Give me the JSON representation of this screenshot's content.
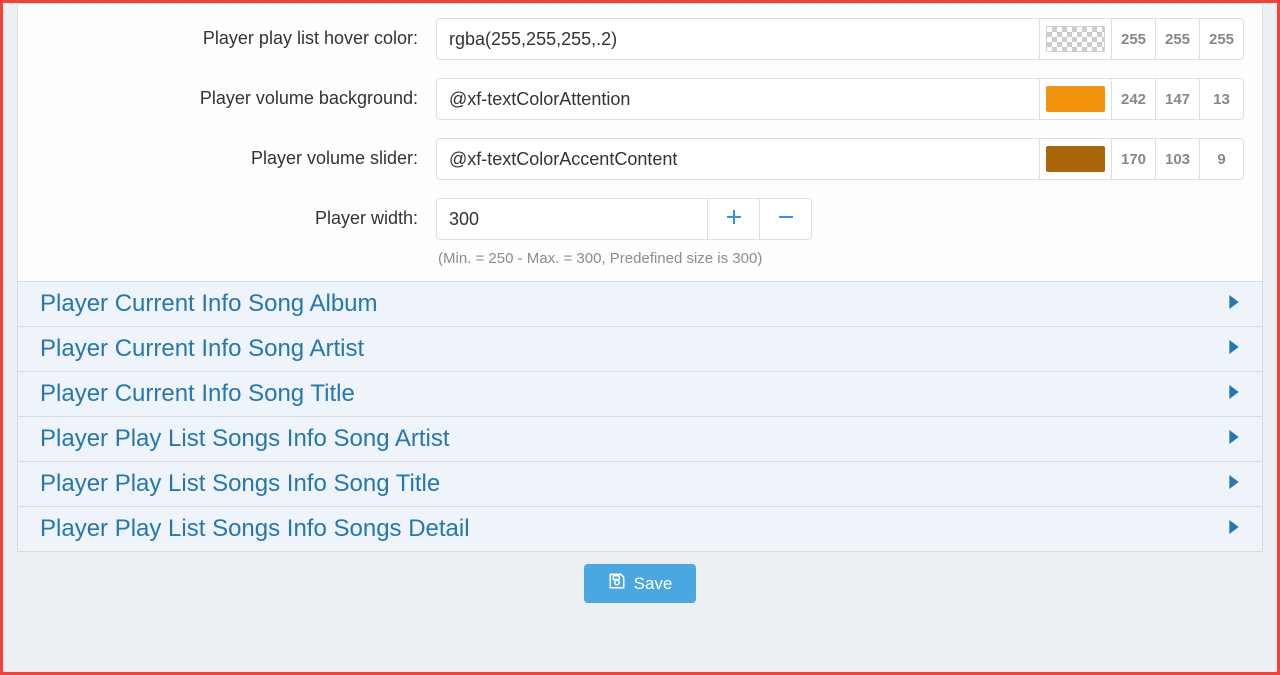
{
  "fields": {
    "hoverColor": {
      "label": "Player play list hover color:",
      "value": "rgba(255,255,255,.2)",
      "swatch": "checker",
      "r": "255",
      "g": "255",
      "b": "255"
    },
    "volumeBg": {
      "label": "Player volume background:",
      "value": "@xf-textColorAttention",
      "swatch": "orange",
      "r": "242",
      "g": "147",
      "b": "13"
    },
    "volumeSlider": {
      "label": "Player volume slider:",
      "value": "@xf-textColorAccentContent",
      "swatch": "brown",
      "r": "170",
      "g": "103",
      "b": "9"
    },
    "width": {
      "label": "Player width:",
      "value": "300",
      "hint": "(Min. = 250 - Max. = 300, Predefined size is 300)"
    }
  },
  "accordion": [
    "Player Current Info Song Album",
    "Player Current Info Song Artist",
    "Player Current Info Song Title",
    "Player Play List Songs Info Song Artist",
    "Player Play List Songs Info Song Title",
    "Player Play List Songs Info Songs Detail"
  ],
  "footer": {
    "saveLabel": "Save"
  }
}
